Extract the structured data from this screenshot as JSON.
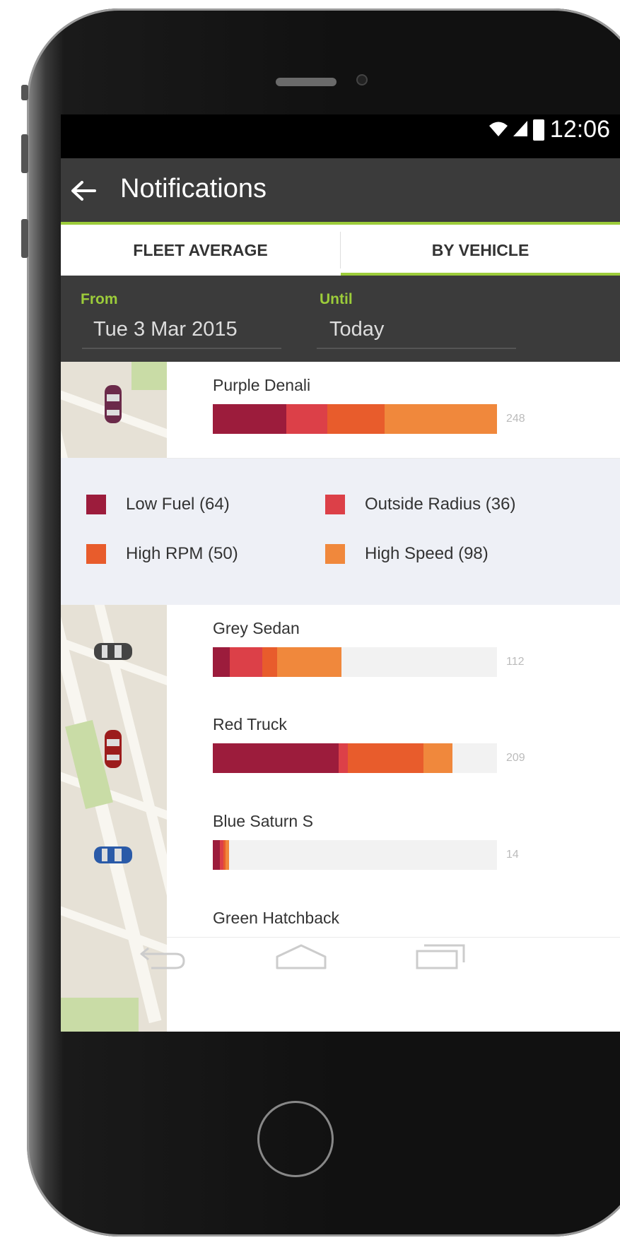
{
  "status_bar": {
    "time": "12:06",
    "icons": [
      "wifi-icon",
      "signal-icon",
      "battery-icon"
    ]
  },
  "app_bar": {
    "title": "Notifications",
    "back_icon": "arrow-left-icon"
  },
  "tabs": [
    {
      "label": "FLEET AVERAGE",
      "active": false
    },
    {
      "label": "BY VEHICLE",
      "active": true
    }
  ],
  "date_range": {
    "from_label": "From",
    "from_value": "Tue 3 Mar 2015",
    "until_label": "Until",
    "until_value": "Today"
  },
  "colors": {
    "accent": "#9ccc3a",
    "low_fuel": "#9c1c3c",
    "outside_radius": "#dc4048",
    "high_rpm": "#e85c2c",
    "high_speed": "#f0883c"
  },
  "legend": [
    {
      "label": "Low Fuel (64)",
      "color": "#9c1c3c"
    },
    {
      "label": "Outside Radius (36)",
      "color": "#dc4048"
    },
    {
      "label": "High RPM (50)",
      "color": "#e85c2c"
    },
    {
      "label": "High Speed (98)",
      "color": "#f0883c"
    }
  ],
  "scale_max": 248,
  "vehicles": [
    {
      "name": "Purple Denali",
      "total": "248",
      "segments": [
        64,
        36,
        50,
        98
      ],
      "car_color": "#6b2a4a"
    },
    {
      "name": "Grey Sedan",
      "total": "112",
      "segments": [
        15,
        28,
        13,
        56
      ],
      "car_color": "#444444"
    },
    {
      "name": "Red Truck",
      "total": "209",
      "segments": [
        110,
        8,
        66,
        25
      ],
      "car_color": "#9c1c1c"
    },
    {
      "name": "Blue Saturn S",
      "total": "14",
      "segments": [
        6,
        3,
        2,
        3
      ],
      "car_color": "#2a5aa8"
    },
    {
      "name": "Green Hatchback",
      "total": "",
      "segments": [],
      "car_color": "#3a7a3a"
    }
  ]
}
